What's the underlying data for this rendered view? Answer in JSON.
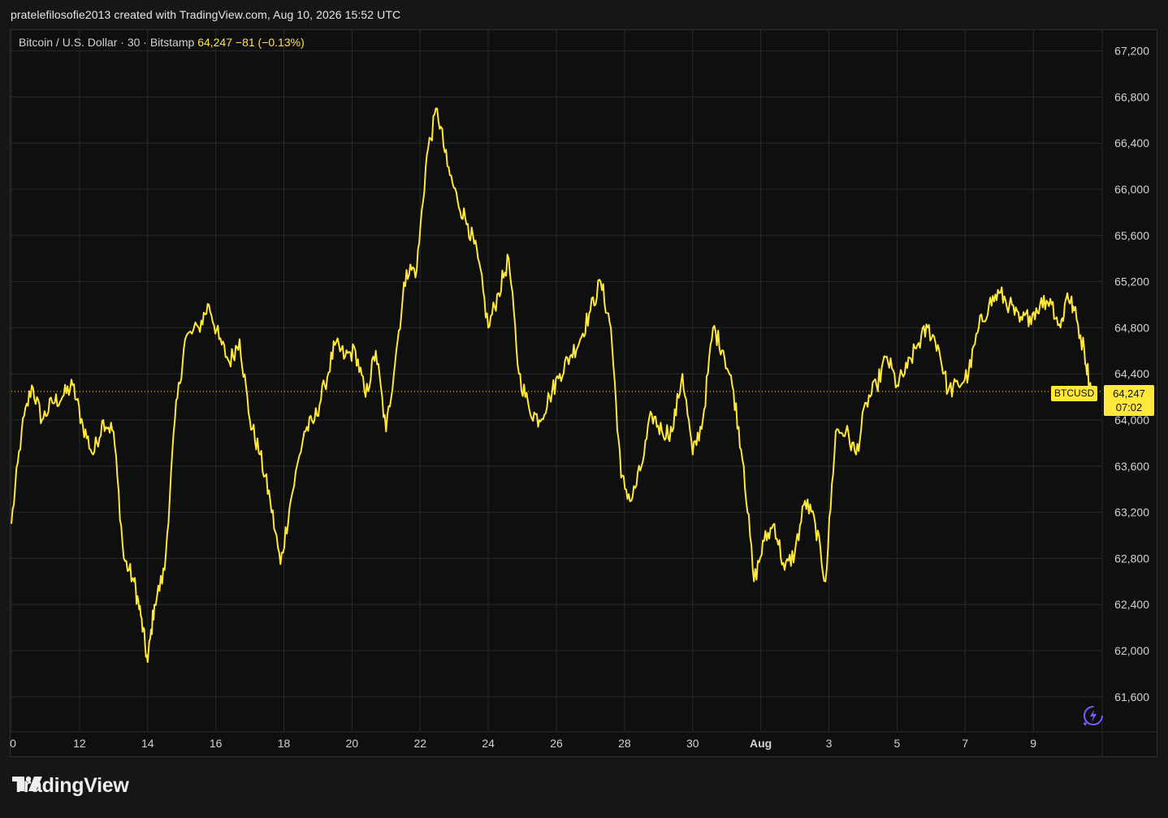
{
  "header": {
    "attribution": "pratelefilosofie2013 created with TradingView.com, Aug 10, 2026 15:52 UTC"
  },
  "legend": {
    "instrument": "Bitcoin / U.S. Dollar · 30 · Bitstamp",
    "last": "64,247",
    "change": "−81",
    "change_pct": "(−0.13%)"
  },
  "price_scale": {
    "last_label": "64,247",
    "countdown": "07:02",
    "symbol": "BTCUSD"
  },
  "brand": {
    "name": "TradingView"
  },
  "colors": {
    "line": "#ffe83a",
    "background": "#0f0f0f",
    "grid": "#2a2a2a",
    "text": "#d2d2d2",
    "accent_icon": "#7b5cff"
  },
  "chart_data": {
    "type": "line",
    "title": "",
    "xlabel": "",
    "ylabel": "",
    "x_ticks": [
      "0",
      "12",
      "14",
      "16",
      "18",
      "20",
      "22",
      "24",
      "26",
      "28",
      "30",
      "Aug",
      "3",
      "5",
      "7",
      "9"
    ],
    "y_ticks": [
      "61,600",
      "62,000",
      "62,400",
      "62,800",
      "63,200",
      "63,600",
      "64,000",
      "64,400",
      "64,800",
      "65,200",
      "65,600",
      "66,000",
      "66,400",
      "66,800",
      "67,200"
    ],
    "ylim": [
      61400,
      67300
    ],
    "grid": true,
    "last_price": 64247,
    "series": [
      {
        "x": [
          10.0,
          10.3,
          10.6,
          10.9,
          11.2,
          11.5,
          11.8,
          12.1,
          12.4,
          12.7,
          13.0,
          13.3,
          13.6,
          13.8,
          14.0,
          14.2,
          14.5,
          14.8,
          15.1,
          15.5,
          15.8,
          16.1,
          16.4,
          16.7,
          17.0,
          17.3,
          17.6,
          17.9,
          18.2,
          18.6,
          18.9,
          19.2,
          19.5,
          19.8,
          20.1,
          20.4,
          20.7,
          21.0,
          21.3,
          21.6,
          21.9,
          22.2,
          22.5,
          22.8,
          23.1,
          23.4,
          23.7,
          24.0,
          24.3,
          24.6,
          24.9,
          25.2,
          25.5,
          25.8,
          26.1,
          26.4,
          26.7,
          27.0,
          27.3,
          27.6,
          27.9,
          28.2,
          28.5,
          28.8,
          29.1,
          29.4,
          29.7,
          30.0,
          30.3,
          30.6,
          30.9,
          31.2,
          31.5,
          31.8,
          32.1,
          32.4,
          32.7,
          33.0,
          33.3,
          33.6,
          33.9,
          34.2,
          34.5,
          34.8,
          35.1,
          35.4,
          35.7,
          36.0,
          36.3,
          36.6,
          36.9,
          37.2,
          37.5,
          37.8,
          38.1,
          38.4,
          38.7,
          39.0,
          39.3,
          39.6,
          39.9,
          40.2,
          40.5,
          40.8,
          41.0,
          41.2,
          41.5,
          41.7
        ],
        "y": [
          63100,
          63900,
          64300,
          64000,
          64150,
          64200,
          64300,
          63950,
          63700,
          64000,
          63900,
          62800,
          62600,
          62300,
          61900,
          62400,
          62700,
          64000,
          64700,
          64800,
          65000,
          64700,
          64500,
          64700,
          64000,
          63700,
          63300,
          62750,
          63300,
          63900,
          64000,
          64300,
          64650,
          64550,
          64600,
          64200,
          64600,
          63900,
          64600,
          65300,
          65300,
          66300,
          66700,
          66200,
          65900,
          65700,
          65400,
          64800,
          65100,
          65400,
          64400,
          64100,
          64000,
          64200,
          64400,
          64550,
          64700,
          64950,
          65200,
          64800,
          63500,
          63300,
          63600,
          64050,
          63900,
          63900,
          64400,
          63700,
          64000,
          64800,
          64600,
          64250,
          63600,
          62600,
          62950,
          63100,
          62700,
          62850,
          63300,
          63100,
          62600,
          63900,
          63900,
          63700,
          64150,
          64300,
          64550,
          64300,
          64450,
          64650,
          64800,
          64650,
          64250,
          64300,
          64400,
          64800,
          65000,
          65100,
          65000,
          64850,
          64900,
          65000,
          65050,
          64800,
          65100,
          64950,
          64600,
          64247
        ]
      }
    ]
  }
}
